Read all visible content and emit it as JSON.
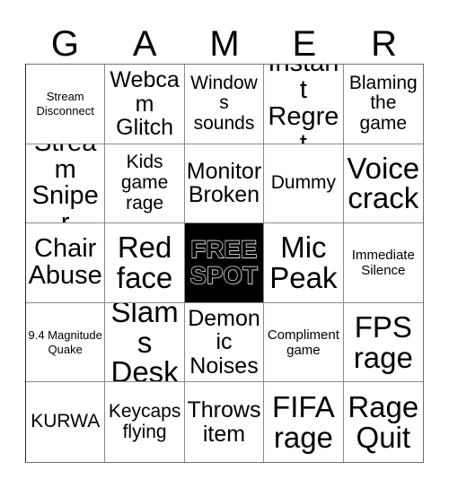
{
  "card": {
    "header_letters": [
      "G",
      "A",
      "M",
      "E",
      "R"
    ],
    "background_color": "#ffffff",
    "text_color": "#000000",
    "grid_line_color": "#8a8a8a",
    "free_space_color": "#000000",
    "rows": 5,
    "columns": 5,
    "cells": [
      {
        "text": "Stream Disconnect",
        "size": "xs",
        "free": false
      },
      {
        "text": "Webcam Glitch",
        "size": "lg",
        "free": false
      },
      {
        "text": "Windows sounds",
        "size": "md",
        "free": false
      },
      {
        "text": "Instant Regret",
        "size": "xl",
        "free": false
      },
      {
        "text": "Blaming the game",
        "size": "md",
        "free": false
      },
      {
        "text": "Stream Sniper",
        "size": "xl",
        "free": false
      },
      {
        "text": "Kids game rage",
        "size": "md",
        "free": false
      },
      {
        "text": "Monitor Broken",
        "size": "lg",
        "free": false
      },
      {
        "text": "Dummy",
        "size": "md",
        "free": false
      },
      {
        "text": "Voice crack",
        "size": "xxl",
        "free": false
      },
      {
        "text": "Chair Abuse",
        "size": "xl",
        "free": false
      },
      {
        "text": "Red face",
        "size": "xxl",
        "free": false
      },
      {
        "text": "FREE SPOT",
        "size": "lg",
        "free": true
      },
      {
        "text": "Mic Peak",
        "size": "xxl",
        "free": false
      },
      {
        "text": "Immediate Silence",
        "size": "sm",
        "free": false
      },
      {
        "text": "9.4 Magnitude Quake",
        "size": "xs",
        "free": false
      },
      {
        "text": "Slams Desk",
        "size": "xxl",
        "free": false
      },
      {
        "text": "Demonic Noises",
        "size": "lg",
        "free": false
      },
      {
        "text": "Compliment game",
        "size": "sm",
        "free": false
      },
      {
        "text": "FPS rage",
        "size": "xxl",
        "free": false
      },
      {
        "text": "KURWA",
        "size": "md",
        "free": false
      },
      {
        "text": "Keycaps flying",
        "size": "md",
        "free": false
      },
      {
        "text": "Throws item",
        "size": "lg",
        "free": false
      },
      {
        "text": "FIFA rage",
        "size": "xxl",
        "free": false
      },
      {
        "text": "Rage Quit",
        "size": "xxl",
        "free": false
      }
    ]
  }
}
